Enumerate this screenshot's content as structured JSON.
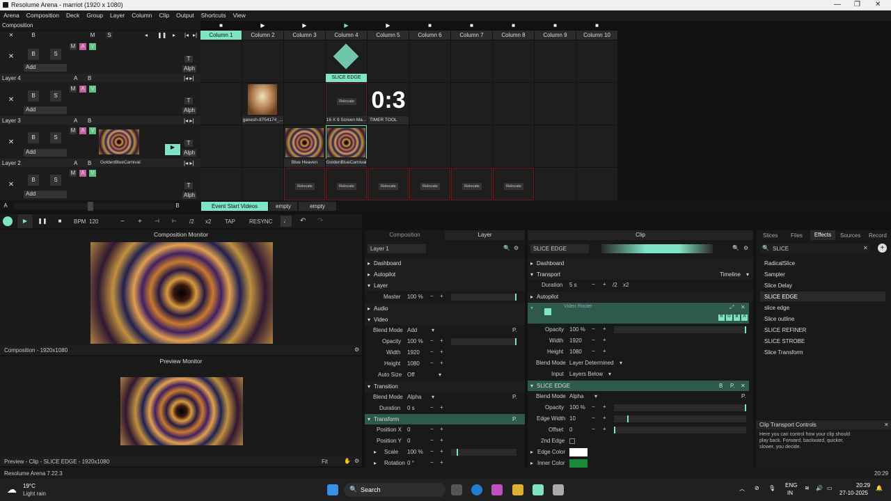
{
  "window": {
    "title": "Resolume Arena - marriot (1920 x 1080)",
    "minimize": "—",
    "maximize": "❐",
    "close": "✕"
  },
  "menu": [
    "Arena",
    "Composition",
    "Deck",
    "Group",
    "Layer",
    "Column",
    "Clip",
    "Output",
    "Shortcuts",
    "View"
  ],
  "composition_label": "Composition",
  "comp_controls": {
    "x": "✕",
    "b": "B",
    "m": "M",
    "s": "S"
  },
  "columns": [
    "Column 1",
    "Column 2",
    "Column 3",
    "Column 4",
    "Column 5",
    "Column 6",
    "Column 7",
    "Column 8",
    "Column 9",
    "Column 10"
  ],
  "layers": [
    {
      "name": "Layer 4",
      "add": "Add"
    },
    {
      "name": "Layer 3",
      "add": "Add"
    },
    {
      "name": "Layer 2",
      "add": "Add"
    },
    {
      "name": "Layer 1",
      "add": "Add"
    }
  ],
  "layer_btns": {
    "b": "B",
    "s": "S",
    "m": "M",
    "a": "A",
    "v": "V",
    "t": "T",
    "alph": "Alph",
    "x": "✕",
    "ab_a": "A",
    "ab_b": "B"
  },
  "clips": {
    "slice_edge": "SLICE EDGE",
    "ganesh": "ganesh-8754174_...",
    "screen": "16 X 9 Screen Ma...",
    "timer_text": "0:3",
    "timer": "TIMER TOOL",
    "blue_heaven": "Blue Heaven",
    "golden": "GoldenBlueCarnival",
    "golden_layer": "GoldenBlueCarnival",
    "relocate": "Relocate"
  },
  "deck": {
    "a": "A",
    "b": "B",
    "event": "Event Start Videos",
    "empty1": "empty",
    "empty2": "empty"
  },
  "transport": {
    "bpm_label": "BPM",
    "bpm": "120",
    "minus": "−",
    "plus": "+",
    "div2": "/2",
    "x2": "x2",
    "tap": "TAP",
    "resync": "RESYNC"
  },
  "comp_monitor": {
    "title": "Composition Monitor",
    "footer": "Composition - 1920x1080"
  },
  "preview_monitor": {
    "title": "Preview Monitor",
    "footer": "Preview - Clip - SLICE EDGE - 1920x1080",
    "fit": "Fit"
  },
  "layer_panel": {
    "tabs": {
      "composition": "Composition",
      "layer": "Layer"
    },
    "name": "Layer 1",
    "dashboard": "Dashboard",
    "autopilot": "Autopilot",
    "layer": "Layer",
    "master_label": "Master",
    "master_val": "100 %",
    "audio": "Audio",
    "video": "Video",
    "blend_label": "Blend Mode",
    "blend_val": "Add",
    "opacity_label": "Opacity",
    "opacity_val": "100 %",
    "width_label": "Width",
    "width_val": "1920",
    "height_label": "Height",
    "height_val": "1080",
    "autosize_label": "Auto Size",
    "autosize_val": "Off",
    "transition": "Transition",
    "tblend_label": "Blend Mode",
    "tblend_val": "Alpha",
    "duration_label": "Duration",
    "duration_val": "0 s",
    "transform": "Transform",
    "posx_label": "Position X",
    "posx_val": "0",
    "posy_label": "Position Y",
    "posy_val": "0",
    "scale_label": "Scale",
    "scale_val": "100 %",
    "rotation_label": "Rotation",
    "rotation_val": "0 °",
    "p": "P."
  },
  "clip_panel": {
    "title": "Clip",
    "name": "SLICE EDGE",
    "dashboard": "Dashboard",
    "transport": "Transport",
    "timeline": "Timeline",
    "duration_label": "Duration",
    "duration_val": "5 s",
    "div2": "/2",
    "x2": "x2",
    "autopilot": "Autopilot",
    "video_router": "Video Router",
    "r": "R",
    "g": "G",
    "b": "B",
    "a": "A",
    "opacity_label": "Opacity",
    "opacity_val": "100 %",
    "width_label": "Width",
    "width_val": "1920",
    "height_label": "Height",
    "height_val": "1080",
    "blend_label": "Blend Mode",
    "blend_val": "Layer Determined",
    "input_label": "Input",
    "input_val": "Layers Below",
    "slice_edge": "SLICE EDGE",
    "sblend_label": "Blend Mode",
    "sblend_val": "Alpha",
    "sopacity_label": "Opacity",
    "sopacity_val": "100 %",
    "edgewidth_label": "Edge Width",
    "edgewidth_val": "10",
    "offset_label": "Offset",
    "offset_val": "0",
    "edge2_label": "2nd Edge",
    "edgecolor_label": "Edge Color",
    "innercolor_label": "Inner Color",
    "edge_color": "#ffffff",
    "inner_color": "#1a8a3a"
  },
  "browser": {
    "tabs": [
      "Slices",
      "Files",
      "Effects",
      "Sources",
      "Record"
    ],
    "search": "SLICE",
    "items": [
      "RadicalSlice",
      "Sampler",
      "Slice Delay",
      "SLICE EDGE",
      "slice edge",
      "Slice outline",
      "SLICE REFINER",
      "SLICE STROBE",
      "Slice Transform"
    ]
  },
  "help": {
    "title": "Clip Transport Controls",
    "text": "Here you can control how your clip should play back. Forward, backward, quicker, slower, you decide."
  },
  "status": {
    "version": "Resolume Arena 7.22.3",
    "time": "20:29"
  },
  "taskbar": {
    "temp": "19°C",
    "weather": "Light rain",
    "search": "Search",
    "lang1": "ENG",
    "lang2": "IN",
    "clock": "20:29",
    "date": "27-10-2025"
  },
  "colors": {
    "accent": "#7fe3c5",
    "magenta": "#c060a0",
    "green_v": "#60c080",
    "red_outline": "#6a1a1a"
  }
}
